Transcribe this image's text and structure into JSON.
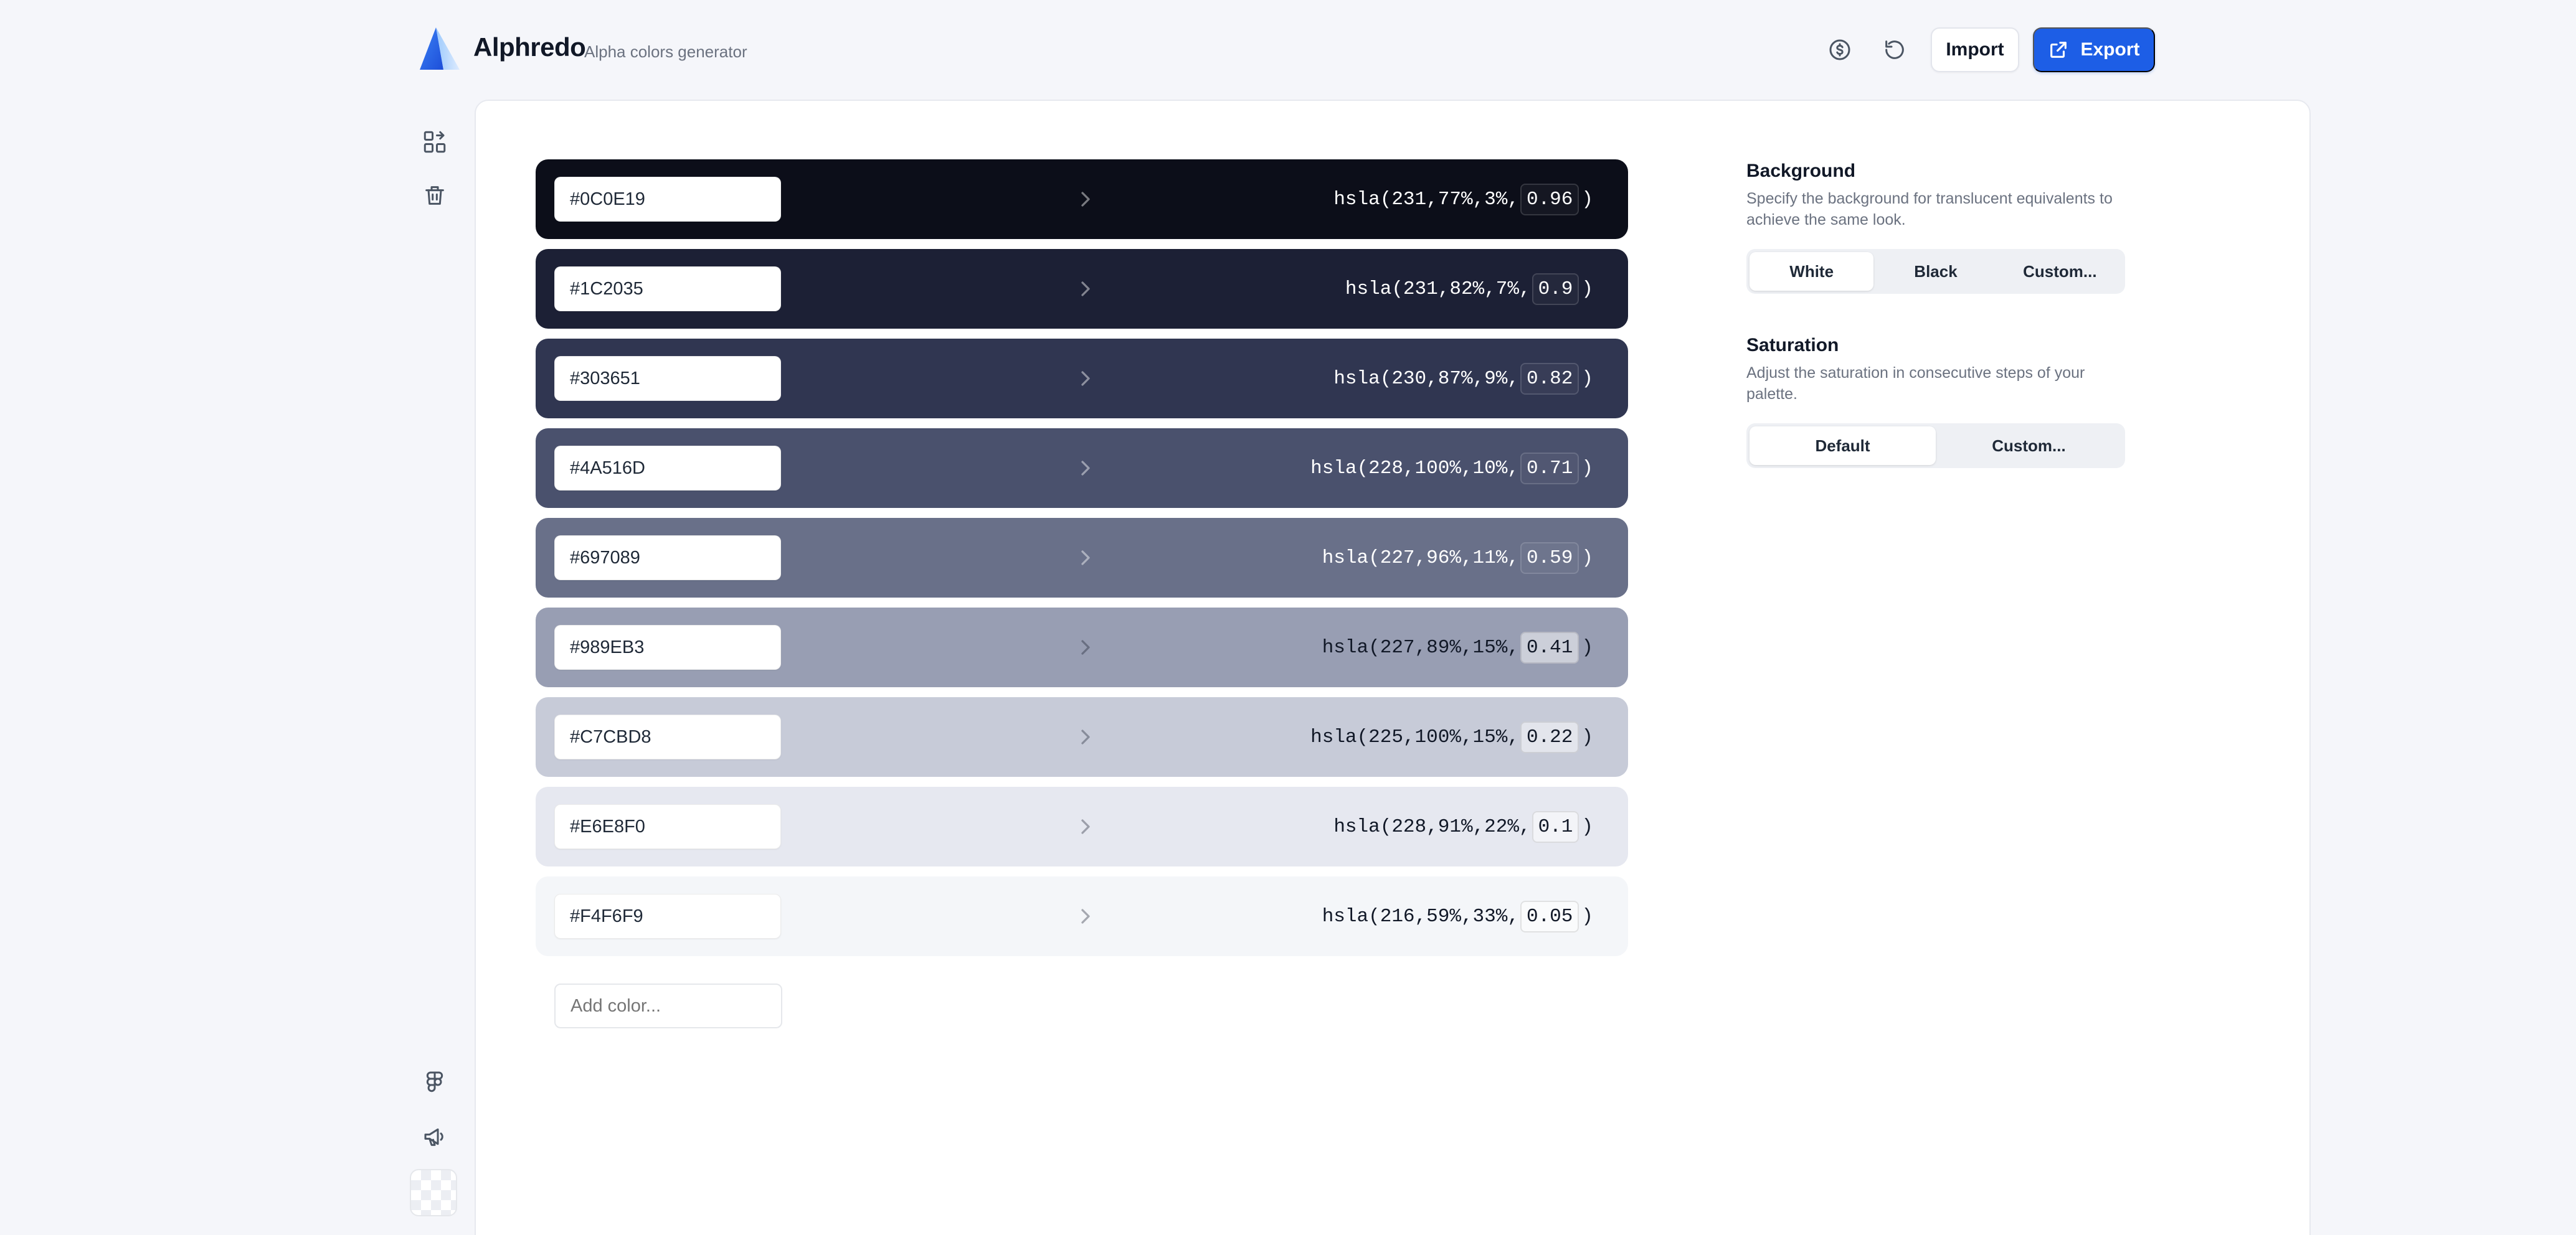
{
  "app": {
    "name": "Alphredo",
    "tagline": "Alpha colors generator"
  },
  "header": {
    "import_label": "Import",
    "export_label": "Export"
  },
  "icons": {
    "header": [
      "info-circle-icon",
      "reset-icon"
    ],
    "rail_top": [
      "shapes-swap-icon",
      "trash-icon"
    ],
    "rail_bottom": [
      "figma-icon",
      "megaphone-icon",
      "checkerboard-background-icon"
    ],
    "row": "chevron-right-icon",
    "export": "external-link-icon"
  },
  "colors": {
    "accent": "#1d5ee6"
  },
  "palette": [
    {
      "hex": "#0C0E19",
      "hsla_prefix": "hsla(231,77%,3%,",
      "alpha": "0.96",
      "hsla_suffix": ")",
      "bg": "#0c0e19",
      "text": "#ffffff"
    },
    {
      "hex": "#1C2035",
      "hsla_prefix": "hsla(231,82%,7%,",
      "alpha": "0.9",
      "hsla_suffix": ")",
      "bg": "#1c2035",
      "text": "#ffffff"
    },
    {
      "hex": "#303651",
      "hsla_prefix": "hsla(230,87%,9%,",
      "alpha": "0.82",
      "hsla_suffix": ")",
      "bg": "#303651",
      "text": "#ffffff"
    },
    {
      "hex": "#4A516D",
      "hsla_prefix": "hsla(228,100%,10%,",
      "alpha": "0.71",
      "hsla_suffix": ")",
      "bg": "#4a516d",
      "text": "#ffffff"
    },
    {
      "hex": "#697089",
      "hsla_prefix": "hsla(227,96%,11%,",
      "alpha": "0.59",
      "hsla_suffix": ")",
      "bg": "#697089",
      "text": "#ffffff"
    },
    {
      "hex": "#989EB3",
      "hsla_prefix": "hsla(227,89%,15%,",
      "alpha": "0.41",
      "hsla_suffix": ")",
      "bg": "#989eb3",
      "text": "#111827"
    },
    {
      "hex": "#C7CBD8",
      "hsla_prefix": "hsla(225,100%,15%,",
      "alpha": "0.22",
      "hsla_suffix": ")",
      "bg": "#c7cbd8",
      "text": "#111827"
    },
    {
      "hex": "#E6E8F0",
      "hsla_prefix": "hsla(228,91%,22%,",
      "alpha": "0.1",
      "hsla_suffix": ")",
      "bg": "#e6e8f0",
      "text": "#111827"
    },
    {
      "hex": "#F4F6F9",
      "hsla_prefix": "hsla(216,59%,33%,",
      "alpha": "0.05",
      "hsla_suffix": ")",
      "bg": "#f4f6f9",
      "text": "#111827"
    }
  ],
  "add_color": {
    "placeholder": "Add color..."
  },
  "settings": {
    "background": {
      "title": "Background",
      "description": "Specify the background for translucent equivalents to achieve the same look.",
      "options": [
        "White",
        "Black",
        "Custom..."
      ],
      "selected": "White"
    },
    "saturation": {
      "title": "Saturation",
      "description": "Adjust the saturation in consecutive steps of your palette.",
      "options": [
        "Default",
        "Custom..."
      ],
      "selected": "Default"
    }
  }
}
